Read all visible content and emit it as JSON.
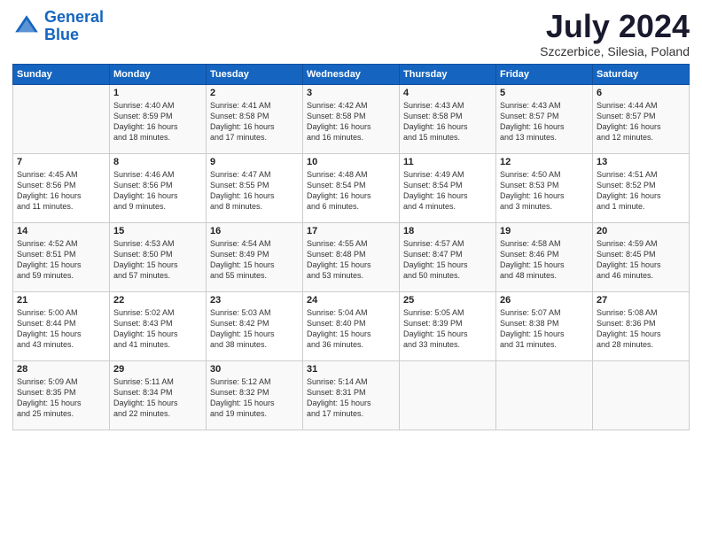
{
  "logo": {
    "line1": "General",
    "line2": "Blue"
  },
  "title": "July 2024",
  "subtitle": "Szczerbice, Silesia, Poland",
  "days_header": [
    "Sunday",
    "Monday",
    "Tuesday",
    "Wednesday",
    "Thursday",
    "Friday",
    "Saturday"
  ],
  "weeks": [
    [
      {
        "num": "",
        "info": ""
      },
      {
        "num": "1",
        "info": "Sunrise: 4:40 AM\nSunset: 8:59 PM\nDaylight: 16 hours\nand 18 minutes."
      },
      {
        "num": "2",
        "info": "Sunrise: 4:41 AM\nSunset: 8:58 PM\nDaylight: 16 hours\nand 17 minutes."
      },
      {
        "num": "3",
        "info": "Sunrise: 4:42 AM\nSunset: 8:58 PM\nDaylight: 16 hours\nand 16 minutes."
      },
      {
        "num": "4",
        "info": "Sunrise: 4:43 AM\nSunset: 8:58 PM\nDaylight: 16 hours\nand 15 minutes."
      },
      {
        "num": "5",
        "info": "Sunrise: 4:43 AM\nSunset: 8:57 PM\nDaylight: 16 hours\nand 13 minutes."
      },
      {
        "num": "6",
        "info": "Sunrise: 4:44 AM\nSunset: 8:57 PM\nDaylight: 16 hours\nand 12 minutes."
      }
    ],
    [
      {
        "num": "7",
        "info": "Sunrise: 4:45 AM\nSunset: 8:56 PM\nDaylight: 16 hours\nand 11 minutes."
      },
      {
        "num": "8",
        "info": "Sunrise: 4:46 AM\nSunset: 8:56 PM\nDaylight: 16 hours\nand 9 minutes."
      },
      {
        "num": "9",
        "info": "Sunrise: 4:47 AM\nSunset: 8:55 PM\nDaylight: 16 hours\nand 8 minutes."
      },
      {
        "num": "10",
        "info": "Sunrise: 4:48 AM\nSunset: 8:54 PM\nDaylight: 16 hours\nand 6 minutes."
      },
      {
        "num": "11",
        "info": "Sunrise: 4:49 AM\nSunset: 8:54 PM\nDaylight: 16 hours\nand 4 minutes."
      },
      {
        "num": "12",
        "info": "Sunrise: 4:50 AM\nSunset: 8:53 PM\nDaylight: 16 hours\nand 3 minutes."
      },
      {
        "num": "13",
        "info": "Sunrise: 4:51 AM\nSunset: 8:52 PM\nDaylight: 16 hours\nand 1 minute."
      }
    ],
    [
      {
        "num": "14",
        "info": "Sunrise: 4:52 AM\nSunset: 8:51 PM\nDaylight: 15 hours\nand 59 minutes."
      },
      {
        "num": "15",
        "info": "Sunrise: 4:53 AM\nSunset: 8:50 PM\nDaylight: 15 hours\nand 57 minutes."
      },
      {
        "num": "16",
        "info": "Sunrise: 4:54 AM\nSunset: 8:49 PM\nDaylight: 15 hours\nand 55 minutes."
      },
      {
        "num": "17",
        "info": "Sunrise: 4:55 AM\nSunset: 8:48 PM\nDaylight: 15 hours\nand 53 minutes."
      },
      {
        "num": "18",
        "info": "Sunrise: 4:57 AM\nSunset: 8:47 PM\nDaylight: 15 hours\nand 50 minutes."
      },
      {
        "num": "19",
        "info": "Sunrise: 4:58 AM\nSunset: 8:46 PM\nDaylight: 15 hours\nand 48 minutes."
      },
      {
        "num": "20",
        "info": "Sunrise: 4:59 AM\nSunset: 8:45 PM\nDaylight: 15 hours\nand 46 minutes."
      }
    ],
    [
      {
        "num": "21",
        "info": "Sunrise: 5:00 AM\nSunset: 8:44 PM\nDaylight: 15 hours\nand 43 minutes."
      },
      {
        "num": "22",
        "info": "Sunrise: 5:02 AM\nSunset: 8:43 PM\nDaylight: 15 hours\nand 41 minutes."
      },
      {
        "num": "23",
        "info": "Sunrise: 5:03 AM\nSunset: 8:42 PM\nDaylight: 15 hours\nand 38 minutes."
      },
      {
        "num": "24",
        "info": "Sunrise: 5:04 AM\nSunset: 8:40 PM\nDaylight: 15 hours\nand 36 minutes."
      },
      {
        "num": "25",
        "info": "Sunrise: 5:05 AM\nSunset: 8:39 PM\nDaylight: 15 hours\nand 33 minutes."
      },
      {
        "num": "26",
        "info": "Sunrise: 5:07 AM\nSunset: 8:38 PM\nDaylight: 15 hours\nand 31 minutes."
      },
      {
        "num": "27",
        "info": "Sunrise: 5:08 AM\nSunset: 8:36 PM\nDaylight: 15 hours\nand 28 minutes."
      }
    ],
    [
      {
        "num": "28",
        "info": "Sunrise: 5:09 AM\nSunset: 8:35 PM\nDaylight: 15 hours\nand 25 minutes."
      },
      {
        "num": "29",
        "info": "Sunrise: 5:11 AM\nSunset: 8:34 PM\nDaylight: 15 hours\nand 22 minutes."
      },
      {
        "num": "30",
        "info": "Sunrise: 5:12 AM\nSunset: 8:32 PM\nDaylight: 15 hours\nand 19 minutes."
      },
      {
        "num": "31",
        "info": "Sunrise: 5:14 AM\nSunset: 8:31 PM\nDaylight: 15 hours\nand 17 minutes."
      },
      {
        "num": "",
        "info": ""
      },
      {
        "num": "",
        "info": ""
      },
      {
        "num": "",
        "info": ""
      }
    ]
  ]
}
